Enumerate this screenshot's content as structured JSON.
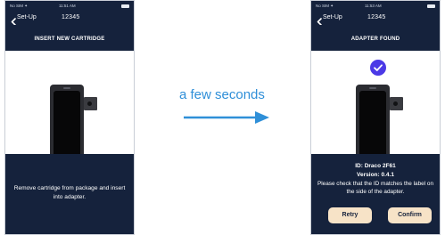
{
  "left_screen": {
    "status_bar": {
      "carrier": "No SIM ✦",
      "time": "11:51 AM"
    },
    "nav": {
      "back_label": "Set-Up",
      "device_id": "12345"
    },
    "heading": "INSERT NEW CARTRIDGE",
    "instruction": "Remove cartridge from package and insert into adapter."
  },
  "transition": {
    "caption": "a few seconds",
    "arrow_color": "#2f8fd8"
  },
  "right_screen": {
    "status_bar": {
      "carrier": "No SIM ✦",
      "time": "11:53 AM"
    },
    "nav": {
      "back_label": "Set-Up",
      "device_id": "12345"
    },
    "heading": "ADAPTER FOUND",
    "adapter_id": "ID: Draco 2F61",
    "version": "Version: 0.4.1",
    "message": "Please check that the ID matches the label on the side of the adapter.",
    "retry_label": "Retry",
    "confirm_label": "Confirm"
  },
  "colors": {
    "navy": "#15223c",
    "button_fill": "#f7e3c7",
    "check_purple": "#4b39e6",
    "caption_blue": "#2f8fd8"
  },
  "icons": [
    "back-chevron-icon",
    "battery-icon",
    "checkmark-icon",
    "right-arrow-icon"
  ]
}
